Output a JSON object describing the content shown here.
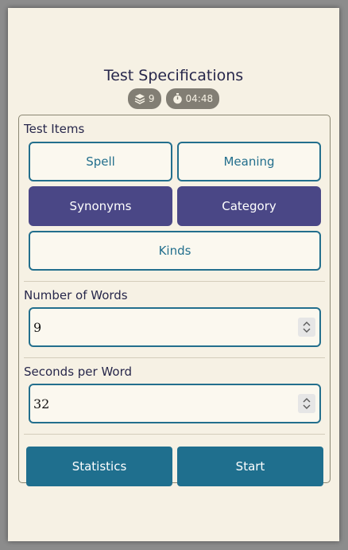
{
  "page": {
    "title": "Test Specifications"
  },
  "badges": {
    "count": {
      "icon": "layers-icon",
      "value": "9"
    },
    "time": {
      "icon": "stopwatch-icon",
      "value": "04:48"
    }
  },
  "test_items": {
    "label": "Test Items",
    "options": [
      {
        "label": "Spell",
        "selected": false
      },
      {
        "label": "Meaning",
        "selected": false
      },
      {
        "label": "Synonyms",
        "selected": true
      },
      {
        "label": "Category",
        "selected": true
      },
      {
        "label": "Kinds",
        "selected": false
      }
    ]
  },
  "number_of_words": {
    "label": "Number of Words",
    "value": "9"
  },
  "seconds_per_word": {
    "label": "Seconds per Word",
    "value": "32"
  },
  "actions": {
    "statistics": "Statistics",
    "start": "Start"
  },
  "colors": {
    "accent": "#1f6f8e",
    "selected": "#4a4786",
    "background": "#f6f1e4",
    "badge": "#827e74",
    "text": "#27274b"
  }
}
